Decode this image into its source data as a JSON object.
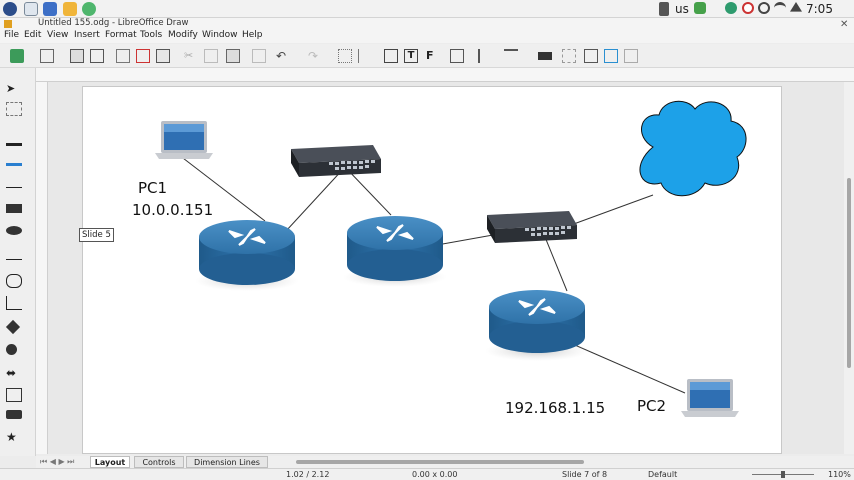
{
  "system_bar": {
    "keyboard_layout": "us",
    "clock": "7:05 PM"
  },
  "window": {
    "title": "Untitled 155.odg - LibreOffice Draw"
  },
  "menu": {
    "items": [
      "File",
      "Edit",
      "View",
      "Insert",
      "Format",
      "Tools",
      "Modify",
      "Window",
      "Help"
    ]
  },
  "slide_tooltip": "Slide 5",
  "diagram": {
    "pc1_name": "PC1",
    "pc1_ip": "10.0.0.151",
    "pc2_ip": "192.168.1.15",
    "pc2_name": "PC2"
  },
  "tabs": [
    "Layout",
    "Controls",
    "Dimension Lines"
  ],
  "status": {
    "position": "1.02 / 2.12",
    "size": "0.00 x 0.00",
    "slide": "Slide 7 of 8",
    "master": "Default",
    "zoom": "110%"
  },
  "colors": {
    "router_top": "#3b7fb4",
    "router_side": "#2a6a9e",
    "cloud": "#1da1e8",
    "switch_body": "#3a3f47"
  }
}
